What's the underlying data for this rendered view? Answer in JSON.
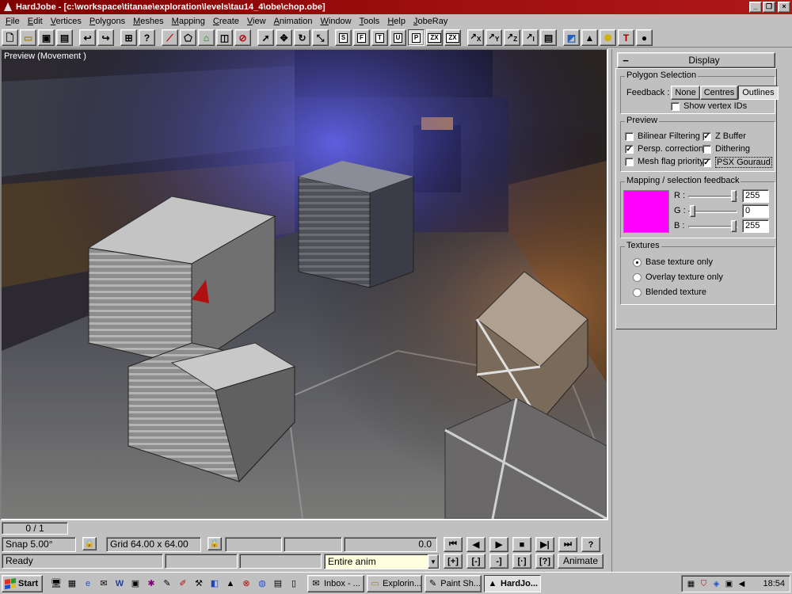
{
  "window": {
    "title": "HardJobe - [c:\\workspace\\titanae\\exploration\\levels\\tau14_4\\obe\\chop.obe]",
    "minimize": "_",
    "restore": "❐",
    "close": "×"
  },
  "menu": [
    "File",
    "Edit",
    "Vertices",
    "Polygons",
    "Meshes",
    "Mapping",
    "Create",
    "View",
    "Animation",
    "Window",
    "Tools",
    "Help",
    "JobeRay"
  ],
  "toolbar": {
    "group1": [
      "new-icon",
      "open-icon",
      "save-icon",
      "save-all-icon"
    ],
    "group2": [
      "undo-icon",
      "redo-icon"
    ],
    "group3": [
      "hierarchy-icon",
      "help-icon"
    ],
    "group4": [
      "line-icon",
      "polygon-icon",
      "house-icon",
      "cube-icon",
      "no-select-icon"
    ],
    "group5": [
      "pointer-icon",
      "move-icon",
      "rotate-icon",
      "scale-icon"
    ],
    "view_buttons": [
      "S",
      "F",
      "T",
      "U",
      "P",
      "ZX",
      "ZX"
    ],
    "axis_buttons": [
      "X",
      "Y",
      "Z",
      "I"
    ],
    "group7": [
      "page-icon",
      "texture-icon",
      "cone-icon",
      "light-icon",
      "hammer-icon",
      "sphere-icon"
    ]
  },
  "viewport": {
    "label": "Preview (Movement )"
  },
  "panel": {
    "title": "Display",
    "collapse": "−",
    "polygon_selection": {
      "title": "Polygon Selection",
      "feedback_label": "Feedback :",
      "buttons": [
        "None",
        "Centres",
        "Outlines"
      ],
      "selected": "Outlines",
      "show_vertex_ids": "Show vertex IDs",
      "show_vertex_ids_checked": false
    },
    "preview": {
      "title": "Preview",
      "options": [
        {
          "label": "Bilinear Filtering",
          "checked": false
        },
        {
          "label": "Z Buffer",
          "checked": true
        },
        {
          "label": "Persp. correction",
          "checked": true
        },
        {
          "label": "Dithering",
          "checked": false
        },
        {
          "label": "Mesh flag priority",
          "checked": false
        },
        {
          "label": "PSX Gouraud",
          "checked": true
        }
      ]
    },
    "mapping": {
      "title": "Mapping / selection feedback",
      "color": "#ff00ff",
      "r_label": "R :",
      "g_label": "G :",
      "b_label": "B :",
      "r": "255",
      "g": "0",
      "b": "255"
    },
    "textures": {
      "title": "Textures",
      "options": [
        "Base texture only",
        "Overlay texture only",
        "Blended texture"
      ],
      "selected": "Base texture only"
    }
  },
  "status": {
    "frame": "0 / 1",
    "snap": "Snap 5.00°",
    "grid": "Grid 64.00 x 64.00",
    "time": "0.0",
    "ready": "Ready",
    "anim_select": "Entire anim",
    "animate": "Animate",
    "media_top": [
      "⏮",
      "◀",
      "▶",
      "■",
      "▶|",
      "⏭",
      "?"
    ],
    "media_bottom": [
      "[+]",
      "[-]",
      "-]",
      "[·]",
      "[?]"
    ]
  },
  "taskbar": {
    "start": "Start",
    "tasks": [
      {
        "label": "Inbox - ...",
        "icon": "envelope-icon"
      },
      {
        "label": "Explorin...",
        "icon": "folder-icon"
      },
      {
        "label": "Paint Sh...",
        "icon": "paint-icon"
      },
      {
        "label": "HardJo...",
        "icon": "hardjobe-icon",
        "active": true
      }
    ],
    "clock": "18:54"
  }
}
